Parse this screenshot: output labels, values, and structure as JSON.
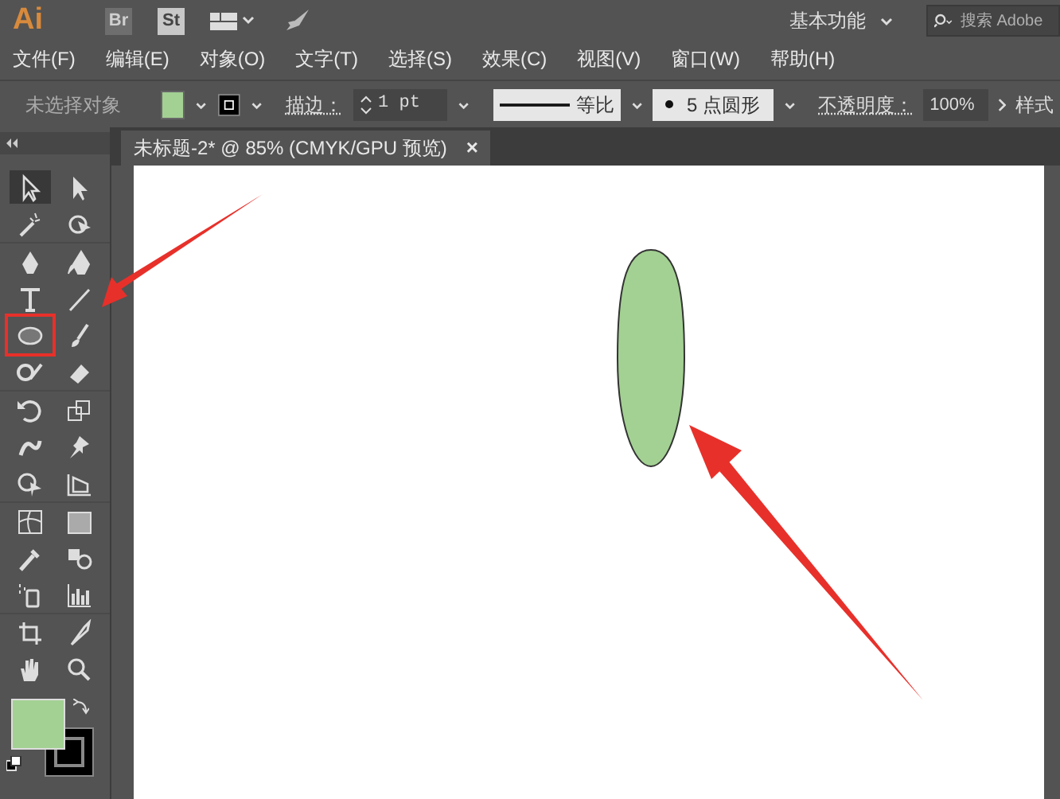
{
  "app_bar": {
    "logo": "Ai",
    "apps": [
      "Br",
      "St"
    ],
    "workspace": "基本功能",
    "search": {
      "placeholder": "搜索 Adobe"
    }
  },
  "menu": [
    "文件(F)",
    "编辑(E)",
    "对象(O)",
    "文字(T)",
    "选择(S)",
    "效果(C)",
    "视图(V)",
    "窗口(W)",
    "帮助(H)"
  ],
  "control_bar": {
    "selection": "未选择对象",
    "stroke_label": "描边：",
    "stroke_weight": "1 pt",
    "profile": "等比",
    "brush": "5 点圆形",
    "opacity_label": "不透明度：",
    "opacity": "100%",
    "style_label": "样式"
  },
  "document_tab": {
    "title": "未标题-2* @ 85% (CMYK/GPU 预览)",
    "close": "×"
  },
  "tool_groups": [
    {
      "tools": [
        {
          "selected": true,
          "marked": false
        },
        {
          "selected": false,
          "marked": false
        },
        {
          "selected": false,
          "marked": false
        },
        {
          "selected": false,
          "marked": false
        }
      ]
    },
    {
      "tools": [
        {
          "selected": false,
          "marked": false
        },
        {
          "selected": false,
          "marked": false
        },
        {
          "selected": false,
          "marked": false
        },
        {
          "selected": false,
          "marked": false
        },
        {
          "selected": false,
          "marked": true
        },
        {
          "selected": false,
          "marked": false
        },
        {
          "selected": false,
          "marked": false
        },
        {
          "selected": false,
          "marked": false
        }
      ]
    },
    {
      "tools": [
        {
          "selected": false,
          "marked": false
        },
        {
          "selected": false,
          "marked": false
        },
        {
          "selected": false,
          "marked": false
        },
        {
          "selected": false,
          "marked": false
        },
        {
          "selected": false,
          "marked": false
        },
        {
          "selected": false,
          "marked": false
        }
      ]
    },
    {
      "tools": [
        {
          "selected": false,
          "marked": false
        },
        {
          "selected": false,
          "marked": false
        },
        {
          "selected": false,
          "marked": false
        },
        {
          "selected": false,
          "marked": false
        },
        {
          "selected": false,
          "marked": false
        },
        {
          "selected": false,
          "marked": false
        }
      ]
    },
    {
      "tools": [
        {
          "selected": false,
          "marked": false
        },
        {
          "selected": false,
          "marked": false
        },
        {
          "selected": false,
          "marked": false
        },
        {
          "selected": false,
          "marked": false
        }
      ]
    }
  ]
}
